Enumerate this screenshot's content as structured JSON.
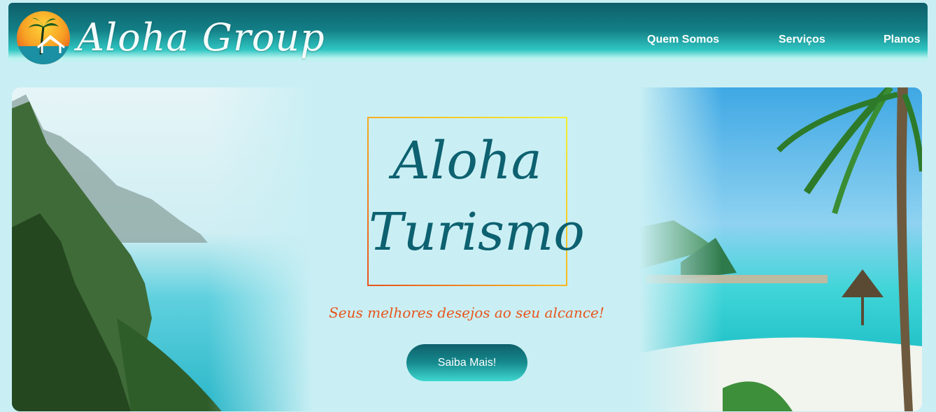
{
  "header": {
    "brand": "Aloha Group",
    "nav": [
      {
        "label": "Quem Somos"
      },
      {
        "label": "Serviços"
      },
      {
        "label": "Planos"
      }
    ]
  },
  "hero": {
    "title_line1": "Aloha",
    "title_line2": "Turismo",
    "tagline": "Seus melhores desejos ao seu alcance!",
    "cta_label": "Saiba Mais!"
  },
  "colors": {
    "header_dark": "#0e5f6a",
    "header_light": "#2fc6c2",
    "page_background": "#c9eff4",
    "title_text": "#0d6170",
    "tagline_text": "#e8551c"
  }
}
